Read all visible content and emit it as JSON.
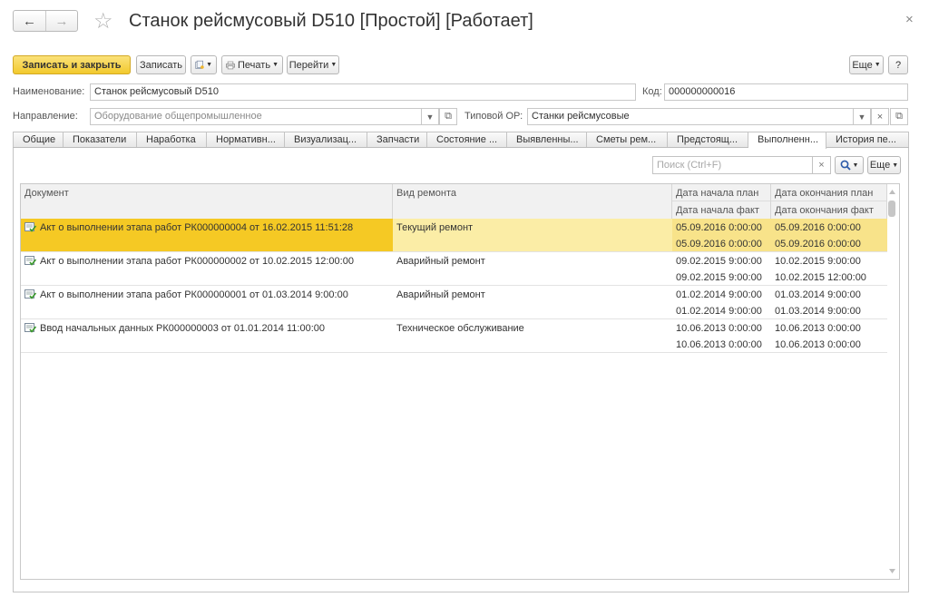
{
  "window": {
    "title": "Станок рейсмусовый D510 [Простой] [Работает]",
    "back_icon": "←",
    "forward_icon": "→",
    "favorite_icon": "☆",
    "close_icon": "×"
  },
  "toolbar": {
    "save_close_label": "Записать и закрыть",
    "save_label": "Записать",
    "print_label": "Печать",
    "goto_label": "Перейти",
    "more_label": "Еще",
    "help_label": "?"
  },
  "form": {
    "name_label": "Наименование:",
    "name_value": "Станок рейсмусовый D510",
    "code_label": "Код:",
    "code_value": "000000000016",
    "direction_label": "Направление:",
    "direction_value": "Оборудование общепромышленное",
    "type_label": "Типовой ОР:",
    "type_value": "Станки рейсмусовые"
  },
  "tabs": [
    {
      "label": "Общие"
    },
    {
      "label": "Показатели"
    },
    {
      "label": "Наработка"
    },
    {
      "label": "Нормативн..."
    },
    {
      "label": "Визуализац..."
    },
    {
      "label": "Запчасти"
    },
    {
      "label": "Состояние ..."
    },
    {
      "label": "Выявленны..."
    },
    {
      "label": "Сметы рем..."
    },
    {
      "label": "Предстоящ..."
    },
    {
      "label": "Выполненн..."
    },
    {
      "label": "История пе..."
    }
  ],
  "search": {
    "placeholder": "Поиск (Ctrl+F)",
    "clear_icon": "×",
    "more_label": "Еще"
  },
  "table": {
    "headers": {
      "document": "Документ",
      "repair_type": "Вид ремонта",
      "plan_start": "Дата начала план",
      "fact_start": "Дата начала факт",
      "plan_end": "Дата окончания план",
      "fact_end": "Дата окончания факт"
    },
    "rows": [
      {
        "document": "Акт о выполнении этапа работ РК000000004 от 16.02.2015 11:51:28",
        "repair_type": "Текущий ремонт",
        "plan_start": "05.09.2016 0:00:00",
        "fact_start": "05.09.2016 0:00:00",
        "plan_end": "05.09.2016 0:00:00",
        "fact_end": "05.09.2016 0:00:00"
      },
      {
        "document": "Акт о выполнении этапа работ РК000000002 от 10.02.2015 12:00:00",
        "repair_type": "Аварийный ремонт",
        "plan_start": "09.02.2015 9:00:00",
        "fact_start": "09.02.2015 9:00:00",
        "plan_end": "10.02.2015 9:00:00",
        "fact_end": "10.02.2015 12:00:00"
      },
      {
        "document": "Акт о выполнении этапа работ РК000000001 от 01.03.2014 9:00:00",
        "repair_type": "Аварийный ремонт",
        "plan_start": "01.02.2014 9:00:00",
        "fact_start": "01.02.2014 9:00:00",
        "plan_end": "01.03.2014 9:00:00",
        "fact_end": "01.03.2014 9:00:00"
      },
      {
        "document": "Ввод начальных данных РК000000003 от 01.01.2014 11:00:00",
        "repair_type": "Техническое обслуживание",
        "plan_start": "10.06.2013 0:00:00",
        "fact_start": "10.06.2013 0:00:00",
        "plan_end": "10.06.2013 0:00:00",
        "fact_end": "10.06.2013 0:00:00"
      }
    ]
  }
}
